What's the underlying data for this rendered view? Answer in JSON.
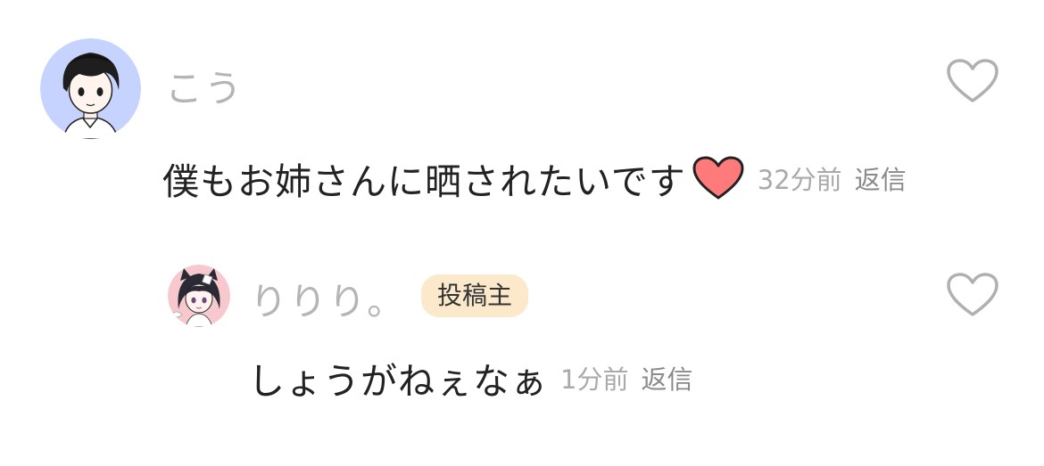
{
  "comment": {
    "author": "こう",
    "text": "僕もお姉さんに晒されたいです",
    "emoji": "red-heart-emoji",
    "time": "32分前",
    "reply_label": "返信",
    "like_icon": "heart-outline-icon"
  },
  "reply": {
    "author": "りりり。",
    "badge": "投稿主",
    "text": "しょうがねぇなぁ",
    "time": "1分前",
    "reply_label": "返信",
    "like_icon": "heart-outline-icon"
  },
  "colors": {
    "username": "#b5b5b5",
    "body_text": "#222222",
    "badge_bg": "#fce9cc",
    "heart_emoji": "#ff7b7b",
    "avatar1_bg": "#c7d3ff",
    "avatar2_bg": "#f7c9cf"
  }
}
